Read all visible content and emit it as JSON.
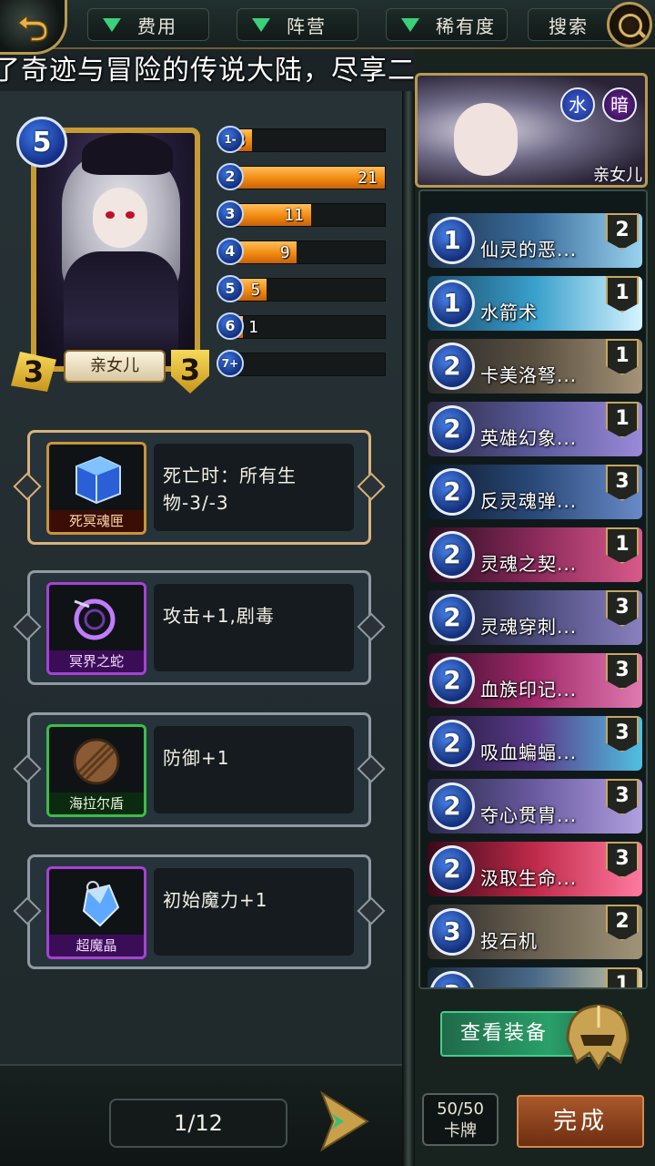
{
  "topbar": {
    "filters": [
      "费用",
      "阵营",
      "稀有度"
    ],
    "search_label": "搜索"
  },
  "marquee": "了奇迹与冒险的传说大陆，尽享二次元TCG的对",
  "hero": {
    "name": "亲女儿",
    "cost": "5",
    "attack": "3",
    "health": "3",
    "factions": [
      "水",
      "暗"
    ]
  },
  "mana_curve": [
    {
      "cost": "1-",
      "count": 3
    },
    {
      "cost": "2",
      "count": 21
    },
    {
      "cost": "3",
      "count": 11
    },
    {
      "cost": "4",
      "count": 9
    },
    {
      "cost": "5",
      "count": 5
    },
    {
      "cost": "6",
      "count": 1
    },
    {
      "cost": "7+",
      "count": 0
    }
  ],
  "relics": [
    {
      "name": "死冥魂匣",
      "desc": "死亡时：所有生物-3/-3"
    },
    {
      "name": "冥界之蛇",
      "desc": "攻击+1,剧毒"
    },
    {
      "name": "海拉尔盾",
      "desc": "防御+1"
    },
    {
      "name": "超魔晶",
      "desc": "初始魔力+1"
    }
  ],
  "page_indicator": "1/12",
  "cards": [
    {
      "cost": "1",
      "name": "仙灵的恶...",
      "count": "2"
    },
    {
      "cost": "1",
      "name": "水箭术",
      "count": "1"
    },
    {
      "cost": "2",
      "name": "卡美洛弩...",
      "count": "1"
    },
    {
      "cost": "2",
      "name": "英雄幻象...",
      "count": "1"
    },
    {
      "cost": "2",
      "name": "反灵魂弹...",
      "count": "3"
    },
    {
      "cost": "2",
      "name": "灵魂之契...",
      "count": "1"
    },
    {
      "cost": "2",
      "name": "灵魂穿刺...",
      "count": "3"
    },
    {
      "cost": "2",
      "name": "血族印记...",
      "count": "3"
    },
    {
      "cost": "2",
      "name": "吸血蝙蝠...",
      "count": "3"
    },
    {
      "cost": "2",
      "name": "夺心贯胄...",
      "count": "3"
    },
    {
      "cost": "2",
      "name": "汲取生命...",
      "count": "3"
    },
    {
      "cost": "3",
      "name": "投石机",
      "count": "2"
    },
    {
      "cost": "3",
      "name": "",
      "count": "1"
    }
  ],
  "view_equip_label": "查看装备",
  "deck_count": {
    "value": "50/50",
    "label": "卡牌"
  },
  "done_label": "完成",
  "colors": {
    "accent_gold": "#c79b34",
    "bar_orange": "#f28a10",
    "mana_blue": "#2f63d8",
    "equip_green": "#2aa06a",
    "done_brown": "#8a4420"
  }
}
